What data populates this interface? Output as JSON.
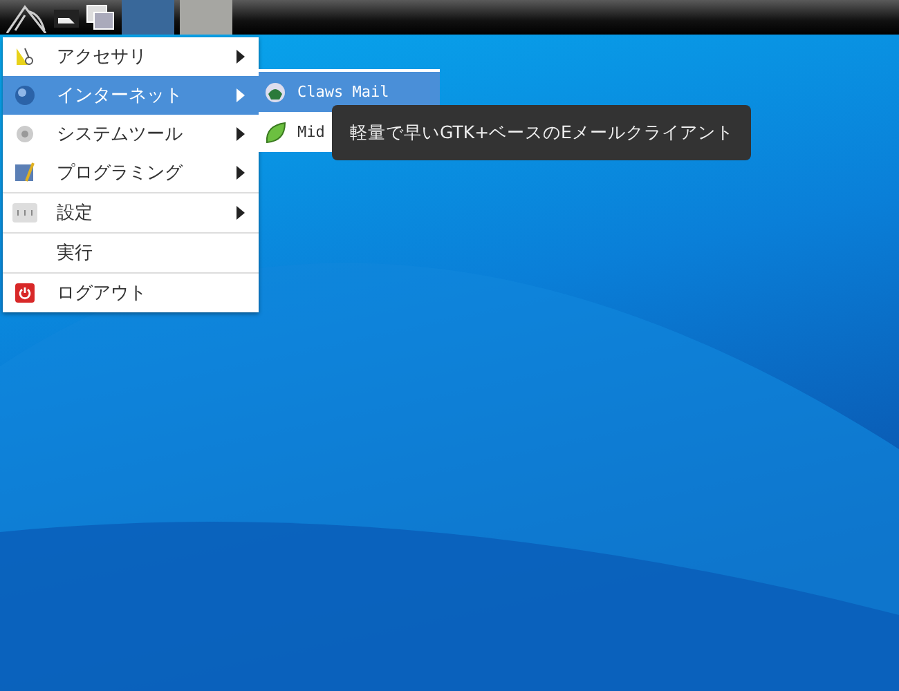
{
  "taskbar": {
    "tasks": [
      {
        "selected": true
      },
      {
        "selected": false
      }
    ]
  },
  "menu": {
    "items": [
      {
        "label": "アクセサリ",
        "kind": "submenu",
        "selected": false,
        "separator": false
      },
      {
        "label": "インターネット",
        "kind": "submenu",
        "selected": true,
        "separator": false
      },
      {
        "label": "システムツール",
        "kind": "submenu",
        "selected": false,
        "separator": false
      },
      {
        "label": "プログラミング",
        "kind": "submenu",
        "selected": false,
        "separator": false
      },
      {
        "label": "設定",
        "kind": "submenu",
        "selected": false,
        "separator": true
      },
      {
        "label": "実行",
        "kind": "command",
        "selected": false,
        "separator": true
      },
      {
        "label": "ログアウト",
        "kind": "command",
        "selected": false,
        "separator": true
      }
    ]
  },
  "submenu": {
    "items": [
      {
        "label": "Claws Mail",
        "selected": true
      },
      {
        "label": "Mid",
        "selected": false
      }
    ]
  },
  "tooltip": {
    "text": "軽量で早いGTK+ベースのEメールクライアント"
  }
}
